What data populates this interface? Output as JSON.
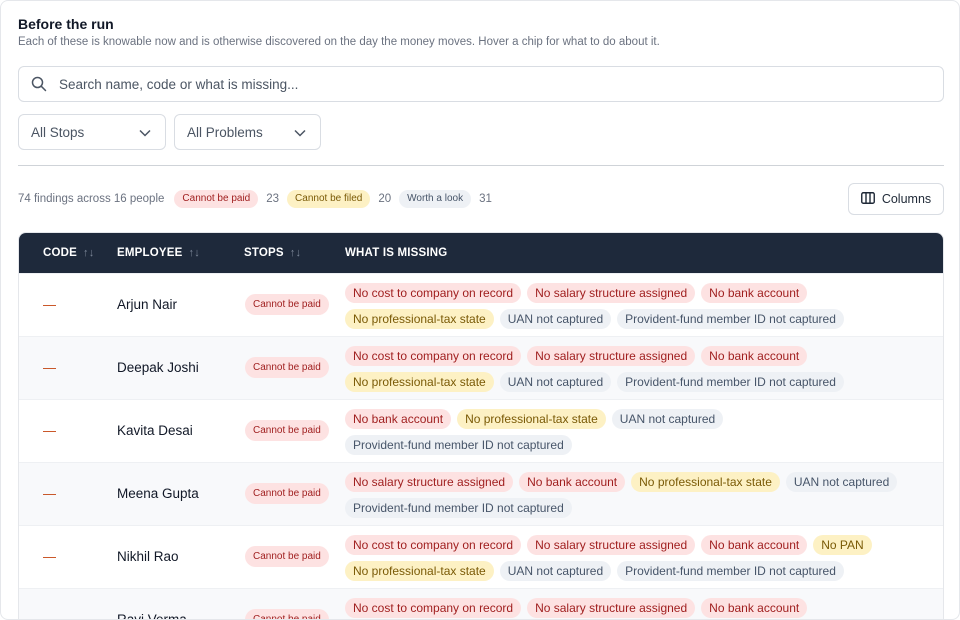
{
  "header": {
    "title": "Before the run",
    "subtitle": "Each of these is knowable now and is otherwise discovered on the day the money moves. Hover a chip for what to do about it."
  },
  "search": {
    "placeholder": "Search name, code or what is missing..."
  },
  "filters": {
    "stops": "All Stops",
    "problems": "All Problems"
  },
  "summary": {
    "text": "74 findings across 16 people",
    "badges": [
      {
        "label": "Cannot be paid",
        "count": "23"
      },
      {
        "label": "Cannot be filed",
        "count": "20"
      },
      {
        "label": "Worth a look",
        "count": "31"
      }
    ]
  },
  "toolbar": {
    "columns_label": "Columns"
  },
  "table": {
    "headers": {
      "code": "CODE",
      "employee": "EMPLOYEE",
      "stops": "STOPS",
      "missing": "WHAT IS MISSING"
    },
    "rows": [
      {
        "code": "—",
        "employee": "Arjun Nair",
        "stop": "Cannot be paid",
        "lines": [
          [
            {
              "t": "No cost to company on record",
              "c": "red"
            },
            {
              "t": "No salary structure assigned",
              "c": "red"
            },
            {
              "t": "No bank account",
              "c": "red"
            }
          ],
          [
            {
              "t": "No professional-tax state",
              "c": "yellow"
            },
            {
              "t": "UAN not captured",
              "c": "gray"
            },
            {
              "t": "Provident-fund member ID not captured",
              "c": "gray"
            }
          ]
        ]
      },
      {
        "code": "—",
        "employee": "Deepak Joshi",
        "stop": "Cannot be paid",
        "lines": [
          [
            {
              "t": "No cost to company on record",
              "c": "red"
            },
            {
              "t": "No salary structure assigned",
              "c": "red"
            },
            {
              "t": "No bank account",
              "c": "red"
            }
          ],
          [
            {
              "t": "No professional-tax state",
              "c": "yellow"
            },
            {
              "t": "UAN not captured",
              "c": "gray"
            },
            {
              "t": "Provident-fund member ID not captured",
              "c": "gray"
            }
          ]
        ]
      },
      {
        "code": "—",
        "employee": "Kavita Desai",
        "stop": "Cannot be paid",
        "lines": [
          [
            {
              "t": "No bank account",
              "c": "red"
            },
            {
              "t": "No professional-tax state",
              "c": "yellow"
            },
            {
              "t": "UAN not captured",
              "c": "gray"
            }
          ],
          [
            {
              "t": "Provident-fund member ID not captured",
              "c": "gray"
            }
          ]
        ]
      },
      {
        "code": "—",
        "employee": "Meena Gupta",
        "stop": "Cannot be paid",
        "lines": [
          [
            {
              "t": "No salary structure assigned",
              "c": "red"
            },
            {
              "t": "No bank account",
              "c": "red"
            },
            {
              "t": "No professional-tax state",
              "c": "yellow"
            },
            {
              "t": "UAN not captured",
              "c": "gray"
            }
          ],
          [
            {
              "t": "Provident-fund member ID not captured",
              "c": "gray"
            }
          ]
        ]
      },
      {
        "code": "—",
        "employee": "Nikhil Rao",
        "stop": "Cannot be paid",
        "lines": [
          [
            {
              "t": "No cost to company on record",
              "c": "red"
            },
            {
              "t": "No salary structure assigned",
              "c": "red"
            },
            {
              "t": "No bank account",
              "c": "red"
            },
            {
              "t": "No PAN",
              "c": "yellow"
            }
          ],
          [
            {
              "t": "No professional-tax state",
              "c": "yellow"
            },
            {
              "t": "UAN not captured",
              "c": "gray"
            },
            {
              "t": "Provident-fund member ID not captured",
              "c": "gray"
            }
          ]
        ]
      },
      {
        "code": "—",
        "employee": "Ravi Verma",
        "stop": "Cannot be paid",
        "lines": [
          [
            {
              "t": "No cost to company on record",
              "c": "red"
            },
            {
              "t": "No salary structure assigned",
              "c": "red"
            },
            {
              "t": "No bank account",
              "c": "red"
            }
          ]
        ]
      }
    ]
  }
}
